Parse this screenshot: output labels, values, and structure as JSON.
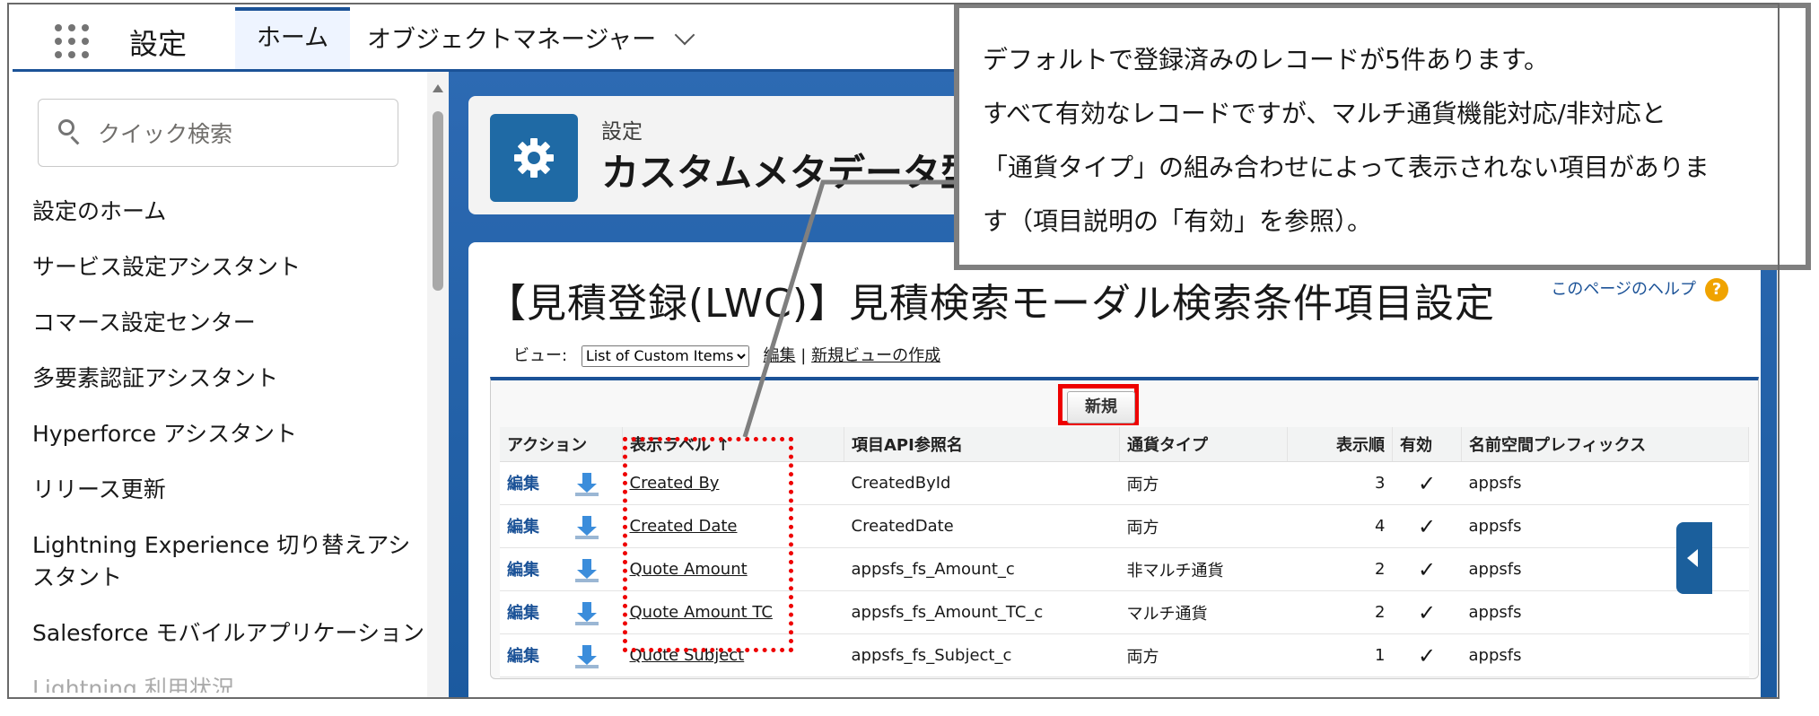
{
  "topnav": {
    "app_name": "設定",
    "tabs": [
      {
        "label": "ホーム",
        "active": true
      },
      {
        "label": "オブジェクトマネージャー",
        "active": false
      }
    ]
  },
  "sidebar": {
    "search_placeholder": "クイック検索",
    "items": [
      "設定のホーム",
      "サービス設定アシスタント",
      "コマース設定センター",
      "多要素認証アシスタント",
      "Hyperforce アシスタント",
      "リリース更新",
      "Lightning Experience 切り替えアシスタント",
      "Salesforce モバイルアプリケーション",
      "Lightning 利用状況"
    ]
  },
  "header": {
    "breadcrumb": "設定",
    "title": "カスタムメタデータ型"
  },
  "content": {
    "page_title": "【見積登録(LWC)】見積検索モーダル検索条件項目設定",
    "help_link": "このページのヘルプ",
    "view_label": "ビュー:",
    "view_selected": "List of Custom Items",
    "edit_link": "編集",
    "separator": "|",
    "new_view_link": "新規ビューの作成",
    "new_button": "新規",
    "columns": {
      "action": "アクション",
      "label": "表示ラベル ↑",
      "api": "項目API参照名",
      "currency": "通貨タイプ",
      "order": "表示順",
      "active": "有効",
      "ns": "名前空間プレフィックス"
    },
    "rows": [
      {
        "action": "編集",
        "label": "Created By",
        "api": "CreatedById",
        "currency": "両方",
        "order": "3",
        "active": "✓",
        "ns": "appsfs"
      },
      {
        "action": "編集",
        "label": "Created Date",
        "api": "CreatedDate",
        "currency": "両方",
        "order": "4",
        "active": "✓",
        "ns": "appsfs"
      },
      {
        "action": "編集",
        "label": "Quote Amount",
        "api": "appsfs_fs_Amount_c",
        "currency": "非マルチ通貨",
        "order": "2",
        "active": "✓",
        "ns": "appsfs"
      },
      {
        "action": "編集",
        "label": "Quote Amount TC",
        "api": "appsfs_fs_Amount_TC_c",
        "currency": "マルチ通貨",
        "order": "2",
        "active": "✓",
        "ns": "appsfs"
      },
      {
        "action": "編集",
        "label": "Quote Subject",
        "api": "appsfs_fs_Subject_c",
        "currency": "両方",
        "order": "1",
        "active": "✓",
        "ns": "appsfs"
      }
    ]
  },
  "callout": {
    "lines": [
      "デフォルトで登録済みのレコードが5件あります。",
      "すべて有効なレコードですが、マルチ通貨機能対応/非対応と",
      "「通貨タイプ」の組み合わせによって表示されない項目がありま",
      "す（項目説明の「有効」を参照）。"
    ]
  },
  "colors": {
    "brand_blue": "#1b5297",
    "highlight_red": "#e00000",
    "callout_border": "#7f7f7f"
  }
}
